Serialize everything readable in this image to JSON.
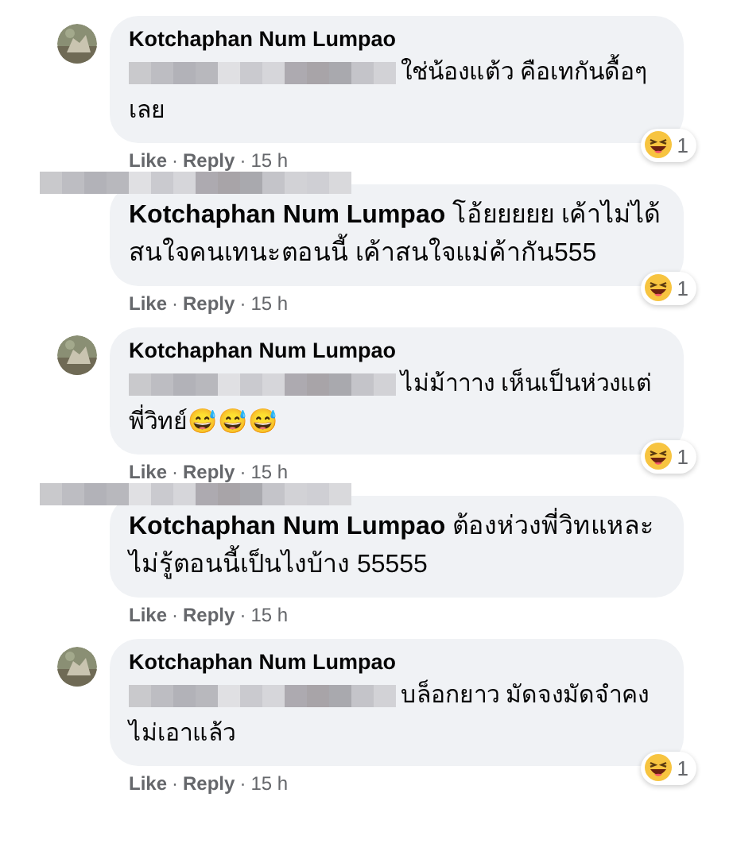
{
  "comments": [
    {
      "author": "Kotchaphan Num Lumpao",
      "author_blurred": false,
      "mention_blurred": true,
      "text": "ใช่น้องแต้ว คือเทกันดื้อๆเลย",
      "reaction_count": "1",
      "actions": [
        "Like",
        "Reply"
      ],
      "separators": [
        "·",
        "·"
      ],
      "time": "15 h"
    },
    {
      "author_blurred": true,
      "mention_blurred": false,
      "text": "**Kotchaphan Num Lumpao** โอ้ยยยยย เค้าไม่ได้สนใจคนเทนะตอนนี้ เค้าสนใจแม่ค้ากัน555",
      "reaction_count": "1",
      "actions": [
        "Like",
        "Reply"
      ],
      "separators": [
        "·",
        "·"
      ],
      "time": "15 h"
    },
    {
      "author": "Kotchaphan Num Lumpao",
      "author_blurred": false,
      "mention_blurred": true,
      "text": "ไม่ม้าาาง เห็นเป็นห่วงแต่พี่วิทย์😅😅😅",
      "reaction_count": "1",
      "actions": [
        "Like",
        "Reply"
      ],
      "separators": [
        "·",
        "·"
      ],
      "time": "15 h"
    },
    {
      "author_blurred": true,
      "mention_blurred": false,
      "text": "**Kotchaphan Num Lumpao** ต้องห่วงพี่วิทแหละ ไม่รู้ตอนนี้เป็นไงบ้าง 55555",
      "actions": [
        "Like",
        "Reply"
      ],
      "separators": [
        "·",
        "·"
      ],
      "time": "15 h"
    },
    {
      "author": "Kotchaphan Num Lumpao",
      "author_blurred": false,
      "mention_blurred": true,
      "text": "บล็อกยาว มัดจงมัดจำคงไม่เอาแล้ว",
      "reaction_count": "1",
      "actions": [
        "Like",
        "Reply"
      ],
      "separators": [
        "·",
        "·"
      ],
      "time": "15 h"
    }
  ]
}
